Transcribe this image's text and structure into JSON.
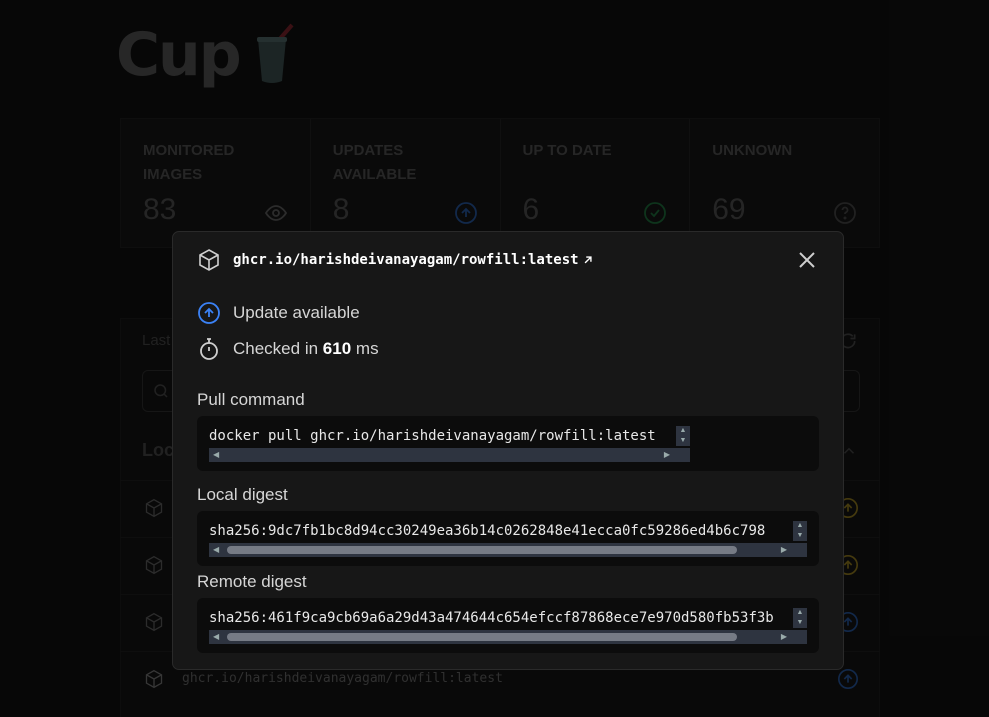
{
  "app": {
    "name": "Cup"
  },
  "stats": [
    {
      "label": "MONITORED IMAGES",
      "value": "83",
      "icon": "eye-icon"
    },
    {
      "label": "UPDATES AVAILABLE",
      "value": "8",
      "icon": "arrow-up-circle-icon"
    },
    {
      "label": "UP TO DATE",
      "value": "6",
      "icon": "check-circle-icon"
    },
    {
      "label": "UNKNOWN",
      "value": "69",
      "icon": "question-circle-icon"
    }
  ],
  "background": {
    "last_checked": "Last",
    "section_title": "Loc",
    "rows": [
      {
        "text": "",
        "status_color": "#c9a227"
      },
      {
        "text": "",
        "status_color": "#c9a227"
      },
      {
        "text": "",
        "status_color": "#3b82f6"
      },
      {
        "text": "ghcr.io/harishdeivanayagam/rowfill:latest",
        "status_color": "#3b82f6"
      }
    ]
  },
  "modal": {
    "title": "ghcr.io/harishdeivanayagam/rowfill:latest",
    "status_text": "Update available",
    "checked_prefix": "Checked in",
    "checked_value": "610",
    "checked_unit": "ms",
    "pull_label": "Pull command",
    "pull_command": "docker pull ghcr.io/harishdeivanayagam/rowfill:latest",
    "local_label": "Local digest",
    "local_digest": "sha256:9dc7fb1bc8d94cc30249ea36b14c0262848e41ecca0fc59286ed4b6c798",
    "remote_label": "Remote digest",
    "remote_digest": "sha256:461f9ca9cb69a6a29d43a474644c654efccf87868ece7e970d580fb53f3b"
  },
  "colors": {
    "accent_blue": "#3b82f6",
    "update_yellow": "#c9a227",
    "ok_green": "#22c55e"
  }
}
